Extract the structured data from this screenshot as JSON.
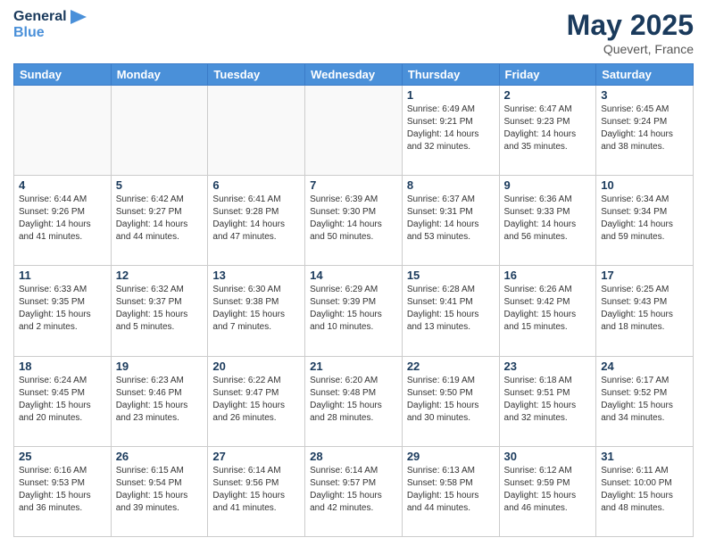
{
  "header": {
    "logo_line1": "General",
    "logo_line2": "Blue",
    "month": "May 2025",
    "location": "Quevert, France"
  },
  "weekdays": [
    "Sunday",
    "Monday",
    "Tuesday",
    "Wednesday",
    "Thursday",
    "Friday",
    "Saturday"
  ],
  "weeks": [
    [
      {
        "day": "",
        "info": ""
      },
      {
        "day": "",
        "info": ""
      },
      {
        "day": "",
        "info": ""
      },
      {
        "day": "",
        "info": ""
      },
      {
        "day": "1",
        "info": "Sunrise: 6:49 AM\nSunset: 9:21 PM\nDaylight: 14 hours\nand 32 minutes."
      },
      {
        "day": "2",
        "info": "Sunrise: 6:47 AM\nSunset: 9:23 PM\nDaylight: 14 hours\nand 35 minutes."
      },
      {
        "day": "3",
        "info": "Sunrise: 6:45 AM\nSunset: 9:24 PM\nDaylight: 14 hours\nand 38 minutes."
      }
    ],
    [
      {
        "day": "4",
        "info": "Sunrise: 6:44 AM\nSunset: 9:26 PM\nDaylight: 14 hours\nand 41 minutes."
      },
      {
        "day": "5",
        "info": "Sunrise: 6:42 AM\nSunset: 9:27 PM\nDaylight: 14 hours\nand 44 minutes."
      },
      {
        "day": "6",
        "info": "Sunrise: 6:41 AM\nSunset: 9:28 PM\nDaylight: 14 hours\nand 47 minutes."
      },
      {
        "day": "7",
        "info": "Sunrise: 6:39 AM\nSunset: 9:30 PM\nDaylight: 14 hours\nand 50 minutes."
      },
      {
        "day": "8",
        "info": "Sunrise: 6:37 AM\nSunset: 9:31 PM\nDaylight: 14 hours\nand 53 minutes."
      },
      {
        "day": "9",
        "info": "Sunrise: 6:36 AM\nSunset: 9:33 PM\nDaylight: 14 hours\nand 56 minutes."
      },
      {
        "day": "10",
        "info": "Sunrise: 6:34 AM\nSunset: 9:34 PM\nDaylight: 14 hours\nand 59 minutes."
      }
    ],
    [
      {
        "day": "11",
        "info": "Sunrise: 6:33 AM\nSunset: 9:35 PM\nDaylight: 15 hours\nand 2 minutes."
      },
      {
        "day": "12",
        "info": "Sunrise: 6:32 AM\nSunset: 9:37 PM\nDaylight: 15 hours\nand 5 minutes."
      },
      {
        "day": "13",
        "info": "Sunrise: 6:30 AM\nSunset: 9:38 PM\nDaylight: 15 hours\nand 7 minutes."
      },
      {
        "day": "14",
        "info": "Sunrise: 6:29 AM\nSunset: 9:39 PM\nDaylight: 15 hours\nand 10 minutes."
      },
      {
        "day": "15",
        "info": "Sunrise: 6:28 AM\nSunset: 9:41 PM\nDaylight: 15 hours\nand 13 minutes."
      },
      {
        "day": "16",
        "info": "Sunrise: 6:26 AM\nSunset: 9:42 PM\nDaylight: 15 hours\nand 15 minutes."
      },
      {
        "day": "17",
        "info": "Sunrise: 6:25 AM\nSunset: 9:43 PM\nDaylight: 15 hours\nand 18 minutes."
      }
    ],
    [
      {
        "day": "18",
        "info": "Sunrise: 6:24 AM\nSunset: 9:45 PM\nDaylight: 15 hours\nand 20 minutes."
      },
      {
        "day": "19",
        "info": "Sunrise: 6:23 AM\nSunset: 9:46 PM\nDaylight: 15 hours\nand 23 minutes."
      },
      {
        "day": "20",
        "info": "Sunrise: 6:22 AM\nSunset: 9:47 PM\nDaylight: 15 hours\nand 26 minutes."
      },
      {
        "day": "21",
        "info": "Sunrise: 6:20 AM\nSunset: 9:48 PM\nDaylight: 15 hours\nand 28 minutes."
      },
      {
        "day": "22",
        "info": "Sunrise: 6:19 AM\nSunset: 9:50 PM\nDaylight: 15 hours\nand 30 minutes."
      },
      {
        "day": "23",
        "info": "Sunrise: 6:18 AM\nSunset: 9:51 PM\nDaylight: 15 hours\nand 32 minutes."
      },
      {
        "day": "24",
        "info": "Sunrise: 6:17 AM\nSunset: 9:52 PM\nDaylight: 15 hours\nand 34 minutes."
      }
    ],
    [
      {
        "day": "25",
        "info": "Sunrise: 6:16 AM\nSunset: 9:53 PM\nDaylight: 15 hours\nand 36 minutes."
      },
      {
        "day": "26",
        "info": "Sunrise: 6:15 AM\nSunset: 9:54 PM\nDaylight: 15 hours\nand 39 minutes."
      },
      {
        "day": "27",
        "info": "Sunrise: 6:14 AM\nSunset: 9:56 PM\nDaylight: 15 hours\nand 41 minutes."
      },
      {
        "day": "28",
        "info": "Sunrise: 6:14 AM\nSunset: 9:57 PM\nDaylight: 15 hours\nand 42 minutes."
      },
      {
        "day": "29",
        "info": "Sunrise: 6:13 AM\nSunset: 9:58 PM\nDaylight: 15 hours\nand 44 minutes."
      },
      {
        "day": "30",
        "info": "Sunrise: 6:12 AM\nSunset: 9:59 PM\nDaylight: 15 hours\nand 46 minutes."
      },
      {
        "day": "31",
        "info": "Sunrise: 6:11 AM\nSunset: 10:00 PM\nDaylight: 15 hours\nand 48 minutes."
      }
    ]
  ]
}
